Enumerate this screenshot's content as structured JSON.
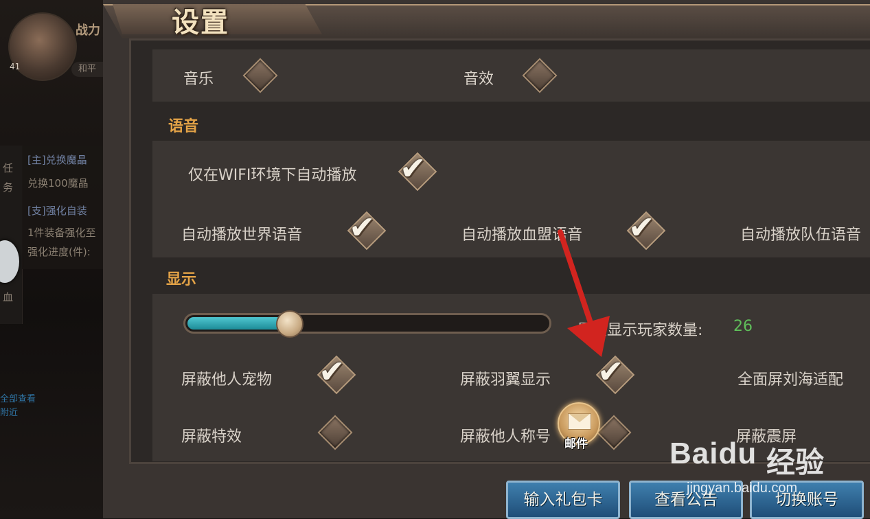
{
  "background": {
    "level": "41",
    "power_label": "战力",
    "mode_label": "和平",
    "quest_lines": [
      {
        "text": "[主]兑换魔晶",
        "style": "title"
      },
      {
        "text": "兑换100魔晶",
        "style": "normal"
      },
      {
        "text": "[支]强化自装",
        "style": "title"
      },
      {
        "text": "1件装备强化至",
        "style": "normal"
      },
      {
        "text": "强化进度(件):",
        "style": "normal"
      }
    ],
    "side_tab_text": [
      "任",
      "务"
    ],
    "side_text_bottom": "血",
    "blue_text": [
      "全部查看",
      "附近"
    ]
  },
  "window": {
    "title": "设置"
  },
  "audio": {
    "music_label": "音乐",
    "sfx_label": "音效"
  },
  "voice": {
    "section_title": "语音",
    "wifi_auto_label": "仅在WIFI环境下自动播放",
    "world_label": "自动播放世界语音",
    "guild_label": "自动播放血盟语音",
    "team_label": "自动播放队伍语音"
  },
  "display": {
    "section_title": "显示",
    "max_players_label": "最大显示玩家数量:",
    "max_players_value": "26",
    "slider_fill_fraction": 0.27,
    "hide_pets_label": "屏蔽他人宠物",
    "hide_wings_label": "屏蔽羽翼显示",
    "notch_label": "全面屏刘海适配",
    "hide_effects_label": "屏蔽特效",
    "hide_titles_label": "屏蔽他人称号",
    "screen_shake_label": "屏蔽震屏"
  },
  "checks": {
    "music": false,
    "sfx": false,
    "wifi_auto": true,
    "world": true,
    "guild": true,
    "hide_pets": true,
    "hide_wings": true,
    "hide_effects": false,
    "hide_titles": false
  },
  "mail": {
    "label": "邮件"
  },
  "buttons": {
    "gift_code": "输入礼包卡",
    "announcement": "查看公告",
    "switch_account": "切换账号"
  },
  "watermark": {
    "logo": "Baidu",
    "cn": "经验",
    "url": "jingyan.baidu.com"
  },
  "colors": {
    "section_title": "#e4a347",
    "max_value": "#5fbe5a",
    "arrow": "#d2241f",
    "button_blue": "#2d6897"
  }
}
